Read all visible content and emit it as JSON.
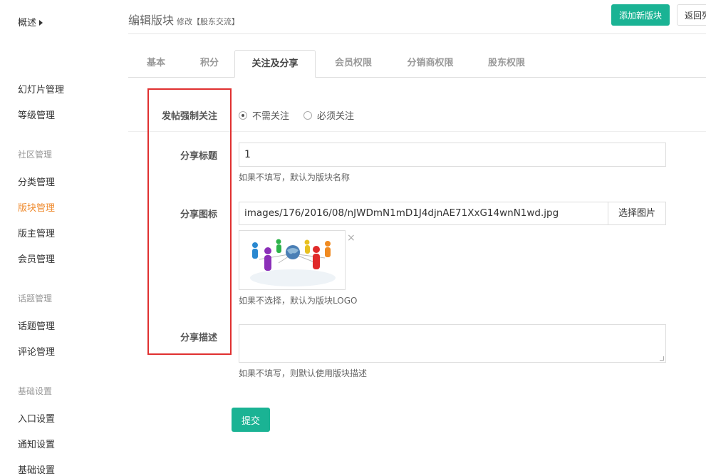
{
  "sidebar": {
    "overview": "概述",
    "items": [
      {
        "label": "幻灯片管理"
      },
      {
        "label": "等级管理"
      },
      {
        "label": "分类管理"
      },
      {
        "label": "版块管理"
      },
      {
        "label": "版主管理"
      },
      {
        "label": "会员管理"
      },
      {
        "label": "话题管理"
      },
      {
        "label": "评论管理"
      },
      {
        "label": "入口设置"
      },
      {
        "label": "通知设置"
      },
      {
        "label": "基础设置"
      }
    ],
    "groups": [
      "社区管理",
      "话题管理",
      "基础设置"
    ],
    "active_index": 3
  },
  "header": {
    "title": "编辑版块",
    "subtitle": "修改【股东交流】",
    "add_button": "添加新版块",
    "back_button": "返回列"
  },
  "tabs": [
    {
      "label": "基本"
    },
    {
      "label": "积分"
    },
    {
      "label": "关注及分享"
    },
    {
      "label": "会员权限"
    },
    {
      "label": "分销商权限"
    },
    {
      "label": "股东权限"
    }
  ],
  "active_tab": 2,
  "form": {
    "follow": {
      "label": "发帖强制关注",
      "options": [
        "不需关注",
        "必须关注"
      ],
      "selected": 0
    },
    "share_title": {
      "label": "分享标题",
      "value": "1",
      "help": "如果不填写，默认为版块名称"
    },
    "share_icon": {
      "label": "分享图标",
      "value": "images/176/2016/08/nJWDmN1mD1J4djnAE71XxG14wnN1wd.jpg",
      "select_button": "选择图片",
      "remove": "×",
      "help": "如果不选择，默认为版块LOGO"
    },
    "share_desc": {
      "label": "分享描述",
      "value": "",
      "help": "如果不填写，则默认使用版块描述"
    },
    "submit": "提交"
  },
  "colors": {
    "accent": "#1ab394",
    "active_nav": "#ef8a2d",
    "highlight_box": "#e03030"
  }
}
